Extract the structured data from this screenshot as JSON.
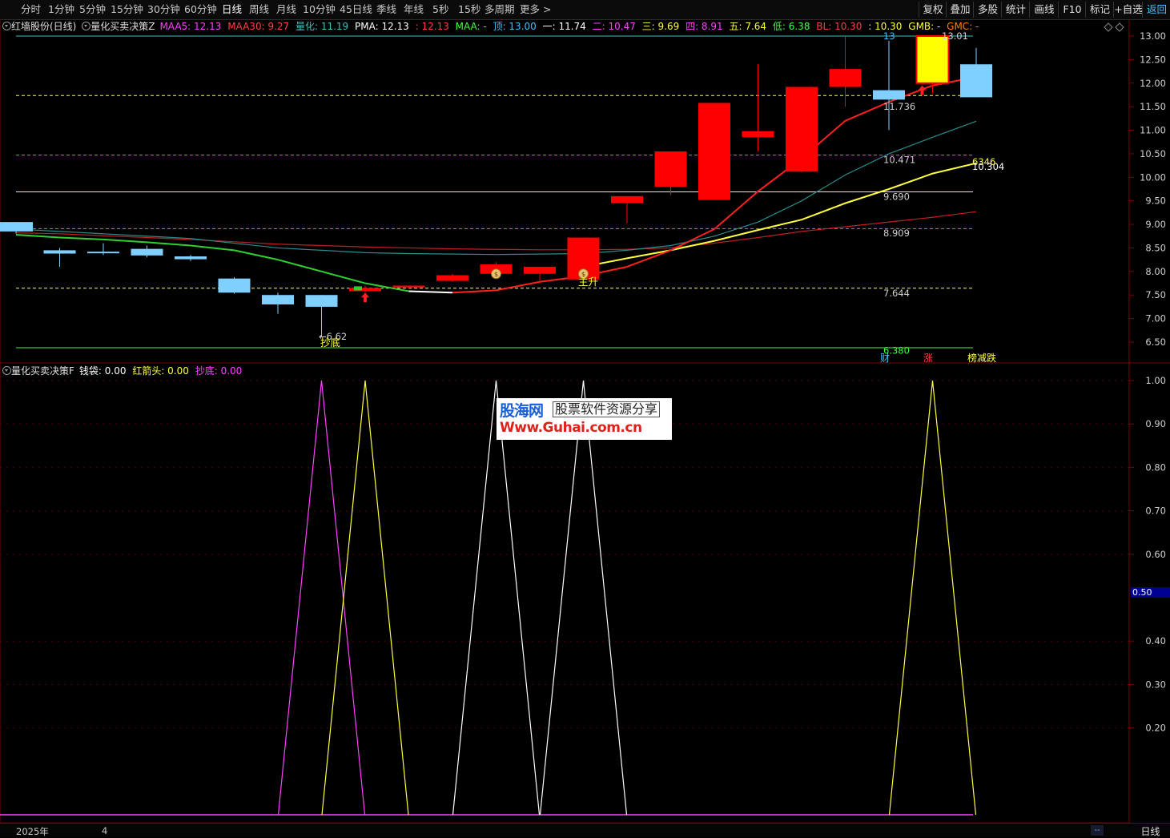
{
  "toolbar": {
    "periods": [
      "分时",
      "1分钟",
      "5分钟",
      "15分钟",
      "30分钟",
      "60分钟",
      "日线",
      "周线",
      "月线",
      "10分钟",
      "45日线",
      "季线",
      "年线",
      "5秒",
      "15秒",
      "多周期",
      "更多 >"
    ],
    "active_period": "日线",
    "right_buttons": [
      "复权",
      "叠加",
      "多股",
      "统计",
      "画线",
      "F10",
      "标记",
      "+自选",
      "返回"
    ]
  },
  "main_info": {
    "stock": "红墙股份(日线)",
    "indicator": "量化买卖决策Z",
    "items": [
      {
        "text": "MAA5: 12.13",
        "color": "#ff40ff"
      },
      {
        "text": "MAA30: 9.27",
        "color": "#ff4040"
      },
      {
        "text": "量化: 11.19",
        "color": "#40c0c0"
      },
      {
        "text": "PMA: 12.13",
        "color": "#ffffff"
      },
      {
        "text": ": 12.13",
        "color": "#ff4040"
      },
      {
        "text": "MAA: -",
        "color": "#40ff40"
      },
      {
        "text": "顶: 13.00",
        "color": "#40c0ff"
      },
      {
        "text": "一: 11.74",
        "color": "#ffffff"
      },
      {
        "text": "二: 10.47",
        "color": "#ff40ff"
      },
      {
        "text": "三: 9.69",
        "color": "#ffff40"
      },
      {
        "text": "四: 8.91",
        "color": "#ff40ff"
      },
      {
        "text": "五: 7.64",
        "color": "#ffff40"
      },
      {
        "text": "低: 6.38",
        "color": "#40ff40"
      },
      {
        "text": "BL: 10.30",
        "color": "#ff4040"
      },
      {
        "text": ": 10.30",
        "color": "#ffff40"
      },
      {
        "text": "GMB: -",
        "color": "#ffff40"
      },
      {
        "text": "GMC: -",
        "color": "#ff8000"
      }
    ]
  },
  "sub_info": {
    "indicator": "量化买卖决策F",
    "items": [
      {
        "text": "钱袋: 0.00",
        "color": "#ffffff"
      },
      {
        "text": "红箭头: 0.00",
        "color": "#ffff40"
      },
      {
        "text": "抄底: 0.00",
        "color": "#ff40ff"
      }
    ]
  },
  "price_axis": [
    "13.00",
    "12.50",
    "12.00",
    "11.50",
    "11.00",
    "10.50",
    "10.00",
    "9.50",
    "9.00",
    "8.50",
    "8.00",
    "7.50",
    "7.00",
    "6.50"
  ],
  "sub_axis": [
    "1.00",
    "0.90",
    "0.80",
    "0.70",
    "0.60",
    "0.40",
    "0.30",
    "0.20"
  ],
  "sub_value_box": "0.50",
  "level_labels": [
    {
      "text": "13",
      "price": 13.0,
      "color": "#40c0ff"
    },
    {
      "text": "13.01",
      "price": 13.0,
      "color": "#d0d0d0"
    },
    {
      "text": "11.736",
      "price": 11.5,
      "color": "#d0d0d0"
    },
    {
      "text": "10.471",
      "price": 10.37,
      "color": "#d0d0d0"
    },
    {
      "text": "10.304",
      "price": 10.23,
      "color": "#ffffff"
    },
    {
      "text": "6346",
      "price": 10.33,
      "color": "#ffff40"
    },
    {
      "text": "9.690",
      "price": 9.59,
      "color": "#d0d0d0"
    },
    {
      "text": "8.909",
      "price": 8.81,
      "color": "#d0d0d0"
    },
    {
      "text": "7.644",
      "price": 7.54,
      "color": "#d0d0d0"
    },
    {
      "text": "6.380",
      "price": 6.32,
      "color": "#40ff40"
    }
  ],
  "annotations": {
    "low_label": "6.62",
    "chaodi": "抄底",
    "zhusheng": "主升",
    "bottom_tags": [
      {
        "text": "财",
        "color": "#40c0ff"
      },
      {
        "text": "涨",
        "color": "#ff4040"
      },
      {
        "text": "榜减跌",
        "color": "#ffff40"
      }
    ]
  },
  "watermark": {
    "title": "股海网",
    "tag": "股票软件资源分享",
    "url": "Www.Guhai.com.cn"
  },
  "bottom": {
    "year": "2025年",
    "month": "4",
    "dash": "--",
    "period": "日线"
  },
  "chart_data": {
    "type": "candlestick",
    "up_color": "#ff0000",
    "down_color": "#7fd0ff",
    "ylim": [
      6.3,
      13.1
    ],
    "candles": [
      {
        "o": 9.05,
        "h": 9.05,
        "l": 8.8,
        "c": 8.85,
        "up": false
      },
      {
        "o": 8.45,
        "h": 8.5,
        "l": 8.1,
        "c": 8.38,
        "up": false
      },
      {
        "o": 8.42,
        "h": 8.6,
        "l": 8.35,
        "c": 8.4,
        "up": false
      },
      {
        "o": 8.48,
        "h": 8.55,
        "l": 8.3,
        "c": 8.34,
        "up": false
      },
      {
        "o": 8.32,
        "h": 8.35,
        "l": 8.22,
        "c": 8.26,
        "up": false
      },
      {
        "o": 7.85,
        "h": 7.88,
        "l": 7.53,
        "c": 7.55,
        "up": false
      },
      {
        "o": 7.5,
        "h": 7.55,
        "l": 7.1,
        "c": 7.3,
        "up": false
      },
      {
        "o": 7.5,
        "h": 7.5,
        "l": 6.62,
        "c": 7.25,
        "up": false
      },
      {
        "o": 7.58,
        "h": 7.7,
        "l": 7.55,
        "c": 7.65,
        "up": true
      },
      {
        "o": 7.66,
        "h": 7.7,
        "l": 7.63,
        "c": 7.7,
        "up": true
      },
      {
        "o": 7.8,
        "h": 7.95,
        "l": 7.78,
        "c": 7.92,
        "up": true
      },
      {
        "o": 7.95,
        "h": 8.2,
        "l": 7.9,
        "c": 8.15,
        "up": true
      },
      {
        "o": 7.95,
        "h": 8.1,
        "l": 7.75,
        "c": 8.1,
        "up": true
      },
      {
        "o": 7.83,
        "h": 8.72,
        "l": 7.83,
        "c": 8.72,
        "up": true
      },
      {
        "o": 9.45,
        "h": 9.6,
        "l": 9.02,
        "c": 9.6,
        "up": true
      },
      {
        "o": 9.8,
        "h": 10.55,
        "l": 9.62,
        "c": 10.55,
        "up": true
      },
      {
        "o": 9.52,
        "h": 11.58,
        "l": 9.52,
        "c": 11.58,
        "up": true
      },
      {
        "o": 10.85,
        "h": 12.4,
        "l": 10.55,
        "c": 10.98,
        "up": true
      },
      {
        "o": 10.12,
        "h": 11.92,
        "l": 10.1,
        "c": 11.92,
        "up": true
      },
      {
        "o": 11.92,
        "h": 13.0,
        "l": 11.5,
        "c": 12.3,
        "up": true
      },
      {
        "o": 11.85,
        "h": 12.9,
        "l": 11.0,
        "c": 11.65,
        "up": false
      },
      {
        "o": 12.0,
        "h": 13.0,
        "l": 11.78,
        "c": 13.0,
        "up": true,
        "yellow": true
      },
      {
        "o": 12.4,
        "h": 12.75,
        "l": 11.7,
        "c": 11.7,
        "up": false
      }
    ],
    "ma_main": [
      8.78,
      8.72,
      8.68,
      8.62,
      8.55,
      8.45,
      8.25,
      8.0,
      7.75,
      7.58,
      7.55,
      7.6,
      7.78,
      7.9,
      8.1,
      8.45,
      8.9,
      9.7,
      10.4,
      11.2,
      11.6,
      11.95,
      12.13
    ],
    "ma_main_colors": [
      "green",
      "green",
      "green",
      "green",
      "green",
      "green",
      "green",
      "green",
      "green",
      "green",
      "white",
      "red",
      "red",
      "red",
      "red",
      "red",
      "red",
      "red",
      "red",
      "red",
      "red",
      "red",
      "red"
    ],
    "ma_yellow": [
      null,
      null,
      null,
      null,
      null,
      null,
      null,
      null,
      null,
      null,
      null,
      null,
      null,
      8.1,
      8.28,
      8.45,
      8.65,
      8.88,
      9.1,
      9.45,
      9.75,
      10.08,
      10.3
    ],
    "ma_cyan": [
      8.9,
      8.85,
      8.8,
      8.75,
      8.7,
      8.6,
      8.5,
      8.45,
      8.4,
      8.38,
      8.37,
      8.36,
      8.37,
      8.38,
      8.45,
      8.55,
      8.75,
      9.05,
      9.5,
      10.05,
      10.5,
      10.85,
      11.19
    ],
    "ma_red": [
      8.82,
      8.8,
      8.76,
      8.72,
      8.68,
      8.63,
      8.58,
      8.55,
      8.52,
      8.5,
      8.48,
      8.47,
      8.46,
      8.46,
      8.47,
      8.5,
      8.6,
      8.72,
      8.85,
      8.95,
      9.05,
      9.15,
      9.27
    ],
    "levels": [
      {
        "price": 13.0,
        "color": "#40c0c0",
        "style": "solid"
      },
      {
        "price": 11.736,
        "color": "#ffff40",
        "style": "dash"
      },
      {
        "price": 10.471,
        "color": "#ff40ff",
        "style": "dash"
      },
      {
        "price": 9.69,
        "color": "#ffff40",
        "style": "solid"
      },
      {
        "price": 8.909,
        "color": "#ff40ff",
        "style": "dash"
      },
      {
        "price": 7.644,
        "color": "#ffff40",
        "style": "dash"
      },
      {
        "price": 6.38,
        "color": "#40ff40",
        "style": "solid"
      }
    ],
    "money_bags": [
      11,
      13
    ],
    "red_arrows": [
      8,
      21
    ],
    "sub_signals": [
      {
        "idx": 7,
        "color": "#ff40ff",
        "value": 1.0
      },
      {
        "idx": 8,
        "color": "#ffff40",
        "value": 1.0
      },
      {
        "idx": 11,
        "color": "#ffffff",
        "value": 1.0
      },
      {
        "idx": 13,
        "color": "#ffffff",
        "value": 1.0
      },
      {
        "idx": 21,
        "color": "#ffff40",
        "value": 1.0
      }
    ],
    "sub_ylim": [
      0,
      1.0
    ]
  }
}
